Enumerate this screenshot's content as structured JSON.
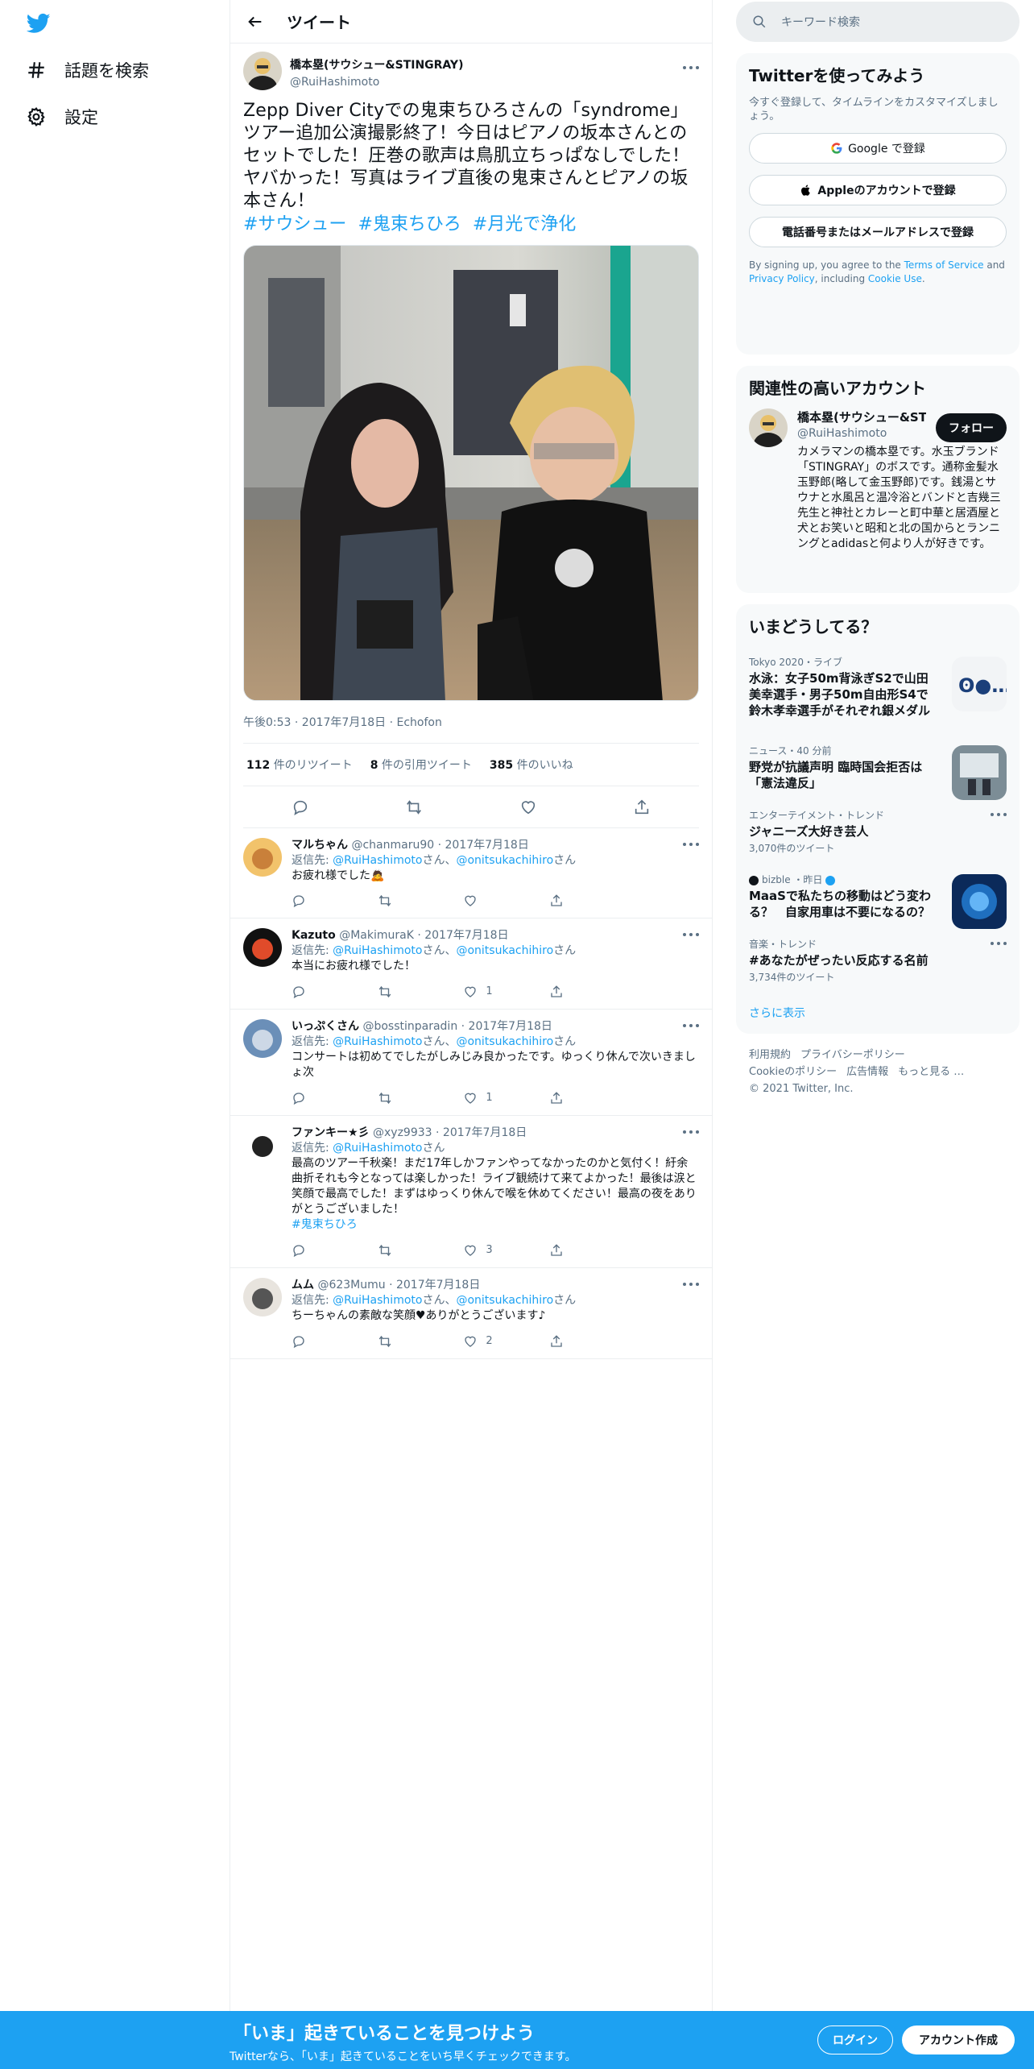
{
  "nav": {
    "explore": "話題を検索",
    "settings": "設定"
  },
  "header": {
    "title": "ツイート"
  },
  "tweet": {
    "author_name": "橋本塁(サウシュー&STINGRAY)",
    "author_handle": "@RuiHashimoto",
    "text": "Zepp Diver Cityでの鬼束ちひろさんの「syndrome」ツアー追加公演撮影終了！今日はピアノの坂本さんとのセットでした！圧巻の歌声は鳥肌立ちっぱなしでした！ヤバかった！写真はライブ直後の鬼束さんとピアノの坂本さん！",
    "hashtags": [
      "#サウシュー",
      "#鬼束ちひろ",
      "#月光で浄化"
    ],
    "meta": "午後0:53 · 2017年7月18日 · Echofon",
    "retweets": "112",
    "retweets_label": "件のリツイート",
    "quotes": "8",
    "quotes_label": "件の引用ツイート",
    "likes": "385",
    "likes_label": "件のいいね"
  },
  "replies": [
    {
      "name": "マルちゃん",
      "handle": "@chanmaru90",
      "date": "· 2017年7月18日",
      "to_prefix": "返信先: ",
      "to1": "@RuiHashimoto",
      "sep": "さん、",
      "to2": "@onitsukachihiro",
      "to_suffix": "さん",
      "text": "お疲れ様でした🙇",
      "likes": ""
    },
    {
      "name": "Kazuto",
      "handle": "@MakimuraK",
      "date": "· 2017年7月18日",
      "to_prefix": "返信先: ",
      "to1": "@RuiHashimoto",
      "sep": "さん、",
      "to2": "@onitsukachihiro",
      "to_suffix": "さん",
      "text": "本当にお疲れ様でした！",
      "likes": "1"
    },
    {
      "name": "いっぷくさん",
      "handle": "@bosstinparadin",
      "date": "· 2017年7月18日",
      "to_prefix": "返信先: ",
      "to1": "@RuiHashimoto",
      "sep": "さん、",
      "to2": "@onitsukachihiro",
      "to_suffix": "さん",
      "text": "コンサートは初めてでしたがしみじみ良かったです。ゆっくり休んで次いきましょ次",
      "likes": "1"
    },
    {
      "name": "ファンキー★彡",
      "handle": "@xyz9933",
      "date": "· 2017年7月18日",
      "to_prefix": "返信先: ",
      "to1": "@RuiHashimoto",
      "sep": "",
      "to2": "",
      "to_suffix": "さん",
      "text": "最高のツアー千秋楽！まだ17年しかファンやってなかったのかと気付く！紆余曲折それも今となっては楽しかった！ライブ観続けて来てよかった！最後は涙と笑顔で最高でした！まずはゆっくり休んで喉を休めてください！最高の夜をありがとうございました！",
      "tag": "#鬼束ちひろ",
      "likes": "3"
    },
    {
      "name": "ムム",
      "handle": "@623Mumu",
      "date": "· 2017年7月18日",
      "to_prefix": "返信先: ",
      "to1": "@RuiHashimoto",
      "sep": "さん、",
      "to2": "@onitsukachihiro",
      "to_suffix": "さん",
      "text": "ちーちゃんの素敵な笑顔♥ありがとうございます♪",
      "likes": "2"
    }
  ],
  "search": {
    "placeholder": "キーワード検索"
  },
  "signup_card": {
    "title": "Twitterを使ってみよう",
    "subtitle": "今すぐ登録して、タイムラインをカスタマイズしましょう。",
    "google": "Google で登録",
    "apple": "Appleのアカウントで登録",
    "phone": "電話番号またはメールアドレスで登録",
    "legal_1": "By signing up, you agree to the ",
    "terms": "Terms of Service",
    "legal_2": " and ",
    "privacy": "Privacy Policy",
    "legal_3": ", including ",
    "cookie": "Cookie Use",
    "legal_4": "."
  },
  "related": {
    "title": "関連性の高いアカウント",
    "name": "橋本塁(サウシュー&STINGRAY)",
    "handle": "@RuiHashimoto",
    "follow": "フォロー",
    "bio": "カメラマンの橋本塁です。水玉ブランド「STINGRAY」のボスです。通称金髪水玉野郎(略して金玉野郎)です。銭湯とサウナと水風呂と温冷浴とバンドと吉幾三先生と神社とカレーと町中華と居酒屋と犬とお笑いと昭和と北の国からとランニングとadidasと何より人が好きです。"
  },
  "trends": {
    "title": "いまどうしてる？",
    "items": [
      {
        "cat": "Tokyo 2020・ライブ",
        "title": "水泳：女子50m背泳ぎS2で山田美幸選手・男子50m自由形S4で鈴木孝幸選手がそれぞれ銀メダル",
        "count": ""
      },
      {
        "cat": "ニュース・40 分前",
        "title": "野党が抗議声明 臨時国会拒否は「憲法違反」",
        "count": ""
      },
      {
        "cat": "エンターテイメント・トレンド",
        "title": "ジャニーズ大好き芸人",
        "count": "3,070件のツイート"
      },
      {
        "cat": "bizble ・昨日",
        "title": "MaaSで私たちの移動はどう変わる？　自家用車は不要になるの？",
        "count": ""
      },
      {
        "cat": "音楽・トレンド",
        "title": "#あなたがぜったい反応する名前",
        "count": "3,734件のツイート"
      }
    ],
    "show_more": "さらに表示"
  },
  "footer": {
    "terms": "利用規約",
    "privacy": "プライバシーポリシー",
    "cookie": "Cookieのポリシー",
    "ads": "広告情報",
    "more": "もっと見る …",
    "copyright": "© 2021 Twitter, Inc."
  },
  "bottombar": {
    "title": "「いま」起きていることを見つけよう",
    "subtitle": "Twitterなら、「いま」起きていることをいち早くチェックできます。",
    "login": "ログイン",
    "signup": "アカウント作成"
  }
}
